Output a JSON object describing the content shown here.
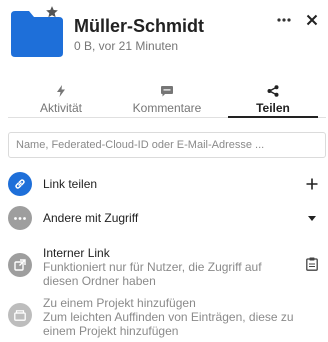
{
  "header": {
    "title": "Müller-Schmidt",
    "meta": "0 B, vor 21 Minuten",
    "folder_color": "#1e6fd9"
  },
  "tabs": [
    {
      "label": "Aktivität",
      "icon": "flash-icon",
      "active": false
    },
    {
      "label": "Kommentare",
      "icon": "comment-icon",
      "active": false
    },
    {
      "label": "Teilen",
      "icon": "share-icon",
      "active": true
    }
  ],
  "search": {
    "placeholder": "Name, Federated-Cloud-ID oder E-Mail-Adresse ...",
    "value": ""
  },
  "items": {
    "link": {
      "label": "Link teilen",
      "icon": "link-icon",
      "action_icon": "plus-icon"
    },
    "others": {
      "label": "Andere mit Zugriff",
      "icon": "more-icon",
      "action_icon": "caret-down-icon"
    },
    "internal": {
      "title": "Interner Link",
      "subtitle": "Funktioniert nur für Nutzer, die Zugriff auf diesen Ordner haben",
      "icon": "external-link-icon",
      "action_icon": "clipboard-icon"
    },
    "project": {
      "title": "Zu einem Projekt hinzufügen",
      "subtitle": "Zum leichten Auffinden von Einträgen, diese zu einem Projekt hinzufügen",
      "icon": "project-icon"
    }
  },
  "colors": {
    "accent": "#1e6fd9",
    "muted_avatar": "#9e9e9e",
    "light_avatar": "#bdbdbd"
  }
}
